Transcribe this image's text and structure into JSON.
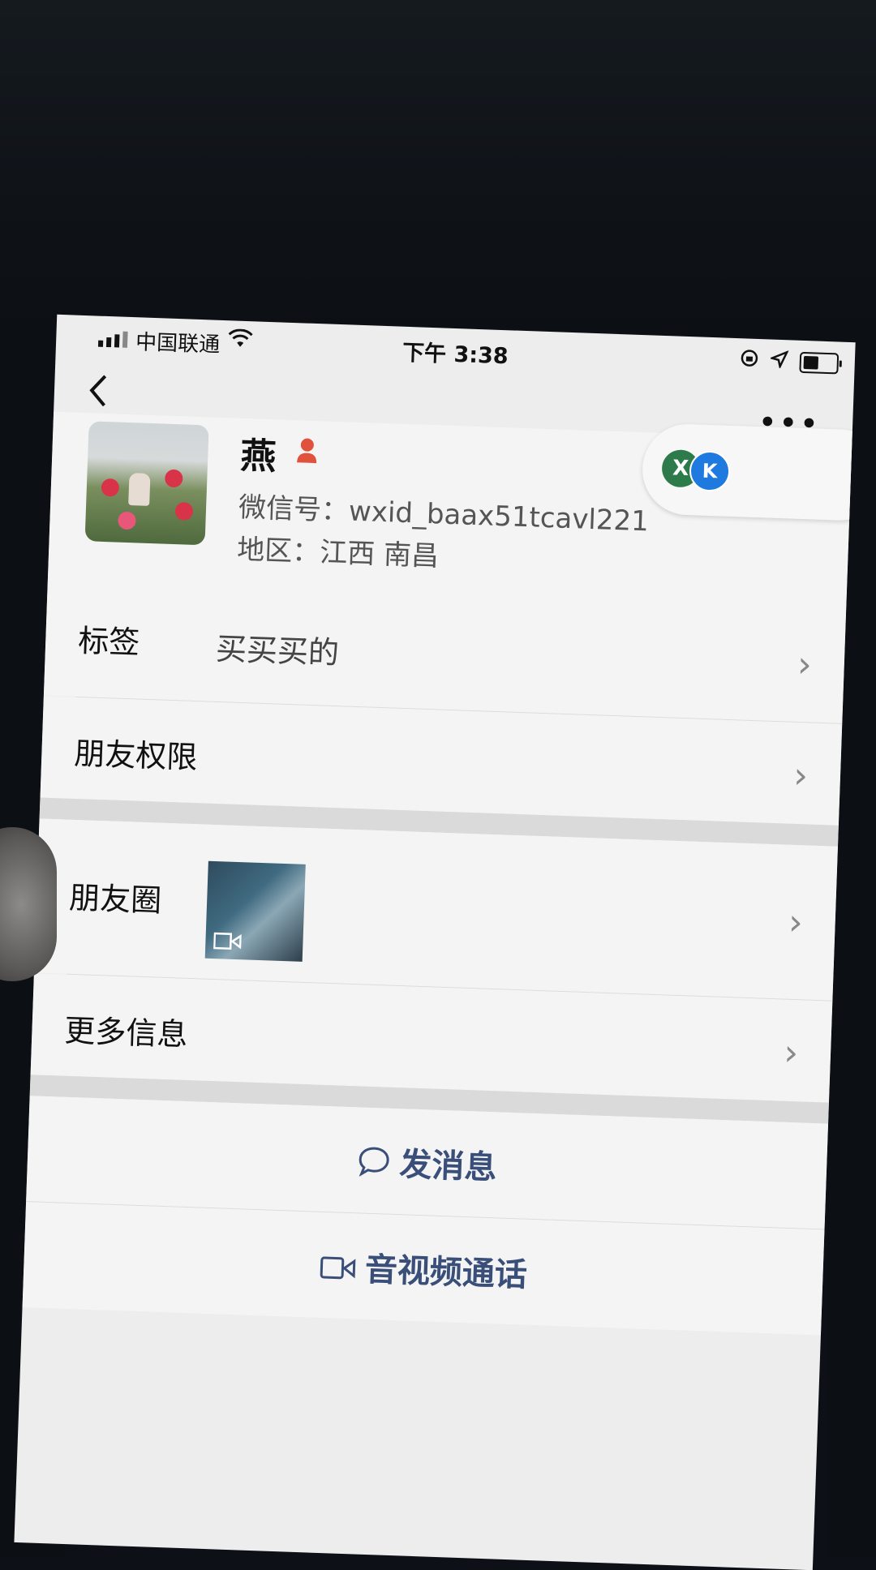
{
  "status_bar": {
    "carrier": "中国联通",
    "time": "下午 3:38"
  },
  "profile": {
    "name": "燕",
    "wechat_id": "微信号：wxid_baax51tcavl221",
    "region": "地区：江西 南昌",
    "badge_left": "X",
    "badge_right": "K"
  },
  "rows": {
    "tags_label": "标签",
    "tags_value": "买买买的",
    "friend_permissions_label": "朋友权限",
    "moments_label": "朋友圈",
    "more_info_label": "更多信息"
  },
  "actions": {
    "send_message": "发消息",
    "video_call": "音视频通话"
  },
  "colors": {
    "accent_text": "#3a4e7a",
    "background": "#ededed",
    "cell_background": "#f4f4f4",
    "gender_female": "#e1523d"
  },
  "icons": [
    "signal-icon",
    "wifi-icon",
    "lock-rotation-icon",
    "location-icon",
    "battery-icon",
    "back-icon",
    "more-icon",
    "female-icon",
    "chevron-right-icon",
    "video-icon",
    "chat-bubble-icon",
    "video-call-icon"
  ]
}
